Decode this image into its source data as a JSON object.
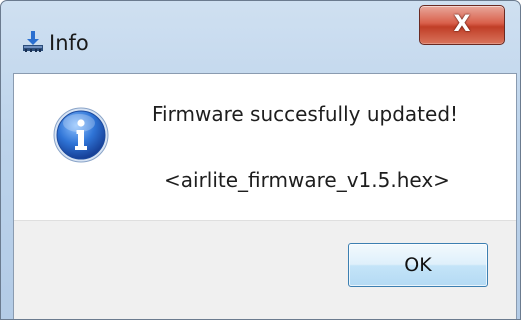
{
  "window": {
    "title": "Info",
    "title_icon": "installer-arrow-icon",
    "close_label": "X",
    "close_color": "#c8432d"
  },
  "dialog": {
    "icon": "info-icon",
    "icon_color": "#1f5fbf",
    "message": "Firmware succesfully updated!",
    "filename": "<airlite_firmware_v1.5.hex>"
  },
  "buttons": {
    "ok_label": "OK"
  }
}
